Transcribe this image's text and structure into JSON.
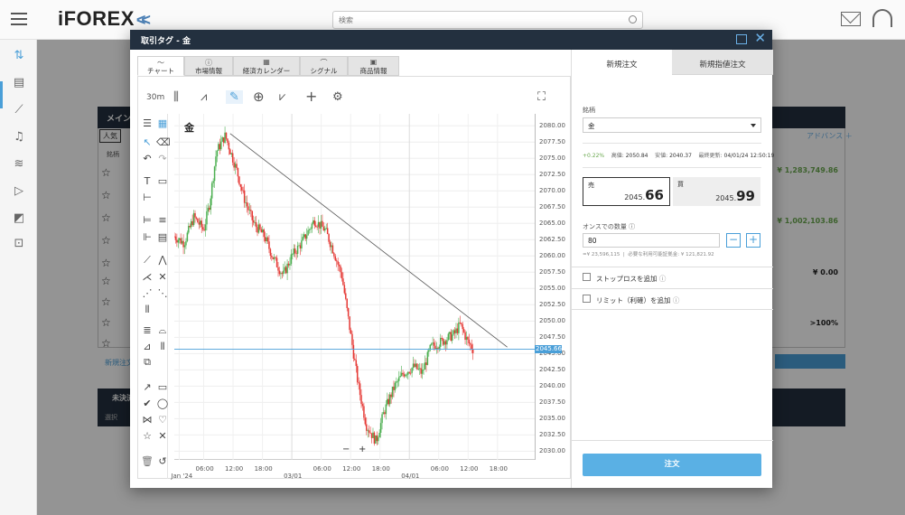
{
  "app": {
    "logo": "iFOREX",
    "logo_chevrons": "<<"
  },
  "search": {
    "placeholder": "検索"
  },
  "background": {
    "panel_title": "メイン",
    "filter": "人気",
    "col": "銘柄",
    "advanced_label": "アドバンス ＋",
    "values": [
      "¥ 1,283,749.86",
      "¥ 1,002,103.86",
      "¥ 0.00",
      ">100%"
    ],
    "new_order_link": "新規注文",
    "lower_title": "未決済",
    "lower_tab": "選択"
  },
  "modal": {
    "title": "取引タグ - 金",
    "tabs": [
      {
        "icon": "chart-icon",
        "label": "チャート"
      },
      {
        "icon": "info-icon",
        "label": "市場情報"
      },
      {
        "icon": "calendar-icon",
        "label": "経済カレンダー"
      },
      {
        "icon": "signal-icon",
        "label": "シグナル"
      },
      {
        "icon": "document-icon",
        "label": "商品情報"
      }
    ]
  },
  "chart_toolbar": {
    "interval": "30m"
  },
  "chart_data": {
    "type": "candlestick",
    "symbol": "金",
    "y_ticks": [
      "2080.00",
      "2077.50",
      "2075.00",
      "2072.50",
      "2070.00",
      "2067.50",
      "2065.00",
      "2062.50",
      "2060.00",
      "2057.50",
      "2055.00",
      "2052.50",
      "2050.00",
      "2047.50",
      "2045.00",
      "2042.50",
      "2040.00",
      "2037.50",
      "2035.00",
      "2032.50",
      "2030.00"
    ],
    "ylim": [
      2029.5,
      2081
    ],
    "current_price": "2045.66",
    "x_ticks": [
      {
        "label": "Jan '24",
        "x": 0.5
      },
      {
        "label": "06:00",
        "x": 3
      },
      {
        "label": "12:00",
        "x": 6
      },
      {
        "label": "18:00",
        "x": 9
      },
      {
        "label": "03/01",
        "x": 12
      },
      {
        "label": "06:00",
        "x": 15
      },
      {
        "label": "12:00",
        "x": 18
      },
      {
        "label": "18:00",
        "x": 21
      },
      {
        "label": "04/01",
        "x": 24
      },
      {
        "label": "06:00",
        "x": 27
      },
      {
        "label": "12:00",
        "x": 30
      },
      {
        "label": "18:00",
        "x": 33
      }
    ],
    "xlim": [
      0,
      36.8
    ],
    "trendline": [
      [
        5.7,
        2078.8
      ],
      [
        34.0,
        2046.0
      ]
    ],
    "keypoints": [
      [
        0,
        2063
      ],
      [
        1,
        2062
      ],
      [
        2,
        2066
      ],
      [
        3,
        2064
      ],
      [
        3.6,
        2068
      ],
      [
        4.3,
        2076
      ],
      [
        5.2,
        2078.5
      ],
      [
        6.4,
        2073
      ],
      [
        7.1,
        2069
      ],
      [
        8.1,
        2065
      ],
      [
        9.2,
        2063
      ],
      [
        10.0,
        2060
      ],
      [
        11.1,
        2057
      ],
      [
        12.0,
        2060
      ],
      [
        13.0,
        2062
      ],
      [
        14.3,
        2065.5
      ],
      [
        15.4,
        2064
      ],
      [
        16.2,
        2061
      ],
      [
        17.1,
        2057
      ],
      [
        18.0,
        2048
      ],
      [
        18.8,
        2040
      ],
      [
        19.6,
        2034
      ],
      [
        20.6,
        2031.5
      ],
      [
        21.4,
        2036
      ],
      [
        22.5,
        2040
      ],
      [
        23.4,
        2042
      ],
      [
        24.5,
        2043
      ],
      [
        25.3,
        2042
      ],
      [
        26.2,
        2046
      ],
      [
        27.5,
        2047
      ],
      [
        28.6,
        2048
      ],
      [
        29.2,
        2049.5
      ],
      [
        29.9,
        2047
      ],
      [
        30.5,
        2045.7
      ]
    ]
  },
  "order_panel": {
    "tab_new": "新規注文",
    "tab_limit": "新規指値注文",
    "instrument_label": "銘柄",
    "instrument_value": "金",
    "change": "+0.22%",
    "high_label": "高値:",
    "high_value": "2050.84",
    "low_label": "安値:",
    "low_value": "2040.37",
    "updated_label": "最終更新:",
    "updated_value": "04/01/24 12:50:19",
    "sell_label": "売",
    "sell_price_main": "2045.",
    "sell_price_big": "66",
    "buy_label": "買",
    "buy_price_main": "2045.",
    "buy_price_big": "99",
    "quantity_label": "オンスでの数量",
    "quantity_value": "80",
    "quantity_info_prefix": "=¥ 23,596,115",
    "margin_label": "必要な利用可能証拠金:",
    "margin_value": "¥ 121,821.92",
    "stoploss_label": "ストップロスを追加",
    "limit_label": "リミット（利確）を追加",
    "order_button": "注文"
  },
  "colors": {
    "accent": "#4a9fd8",
    "up": "#4caf50",
    "down": "#e53935",
    "header": "#23303f"
  }
}
